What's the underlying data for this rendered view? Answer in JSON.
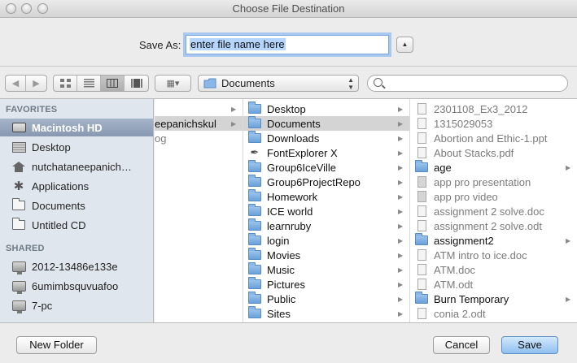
{
  "window": {
    "title": "Choose File Destination"
  },
  "save_as": {
    "label": "Save As:",
    "value": "enter file name here"
  },
  "toolbar": {
    "nav_back": "◀",
    "nav_forward": "▶",
    "arrange_icon": "▦▾",
    "path_selection": "Documents",
    "search_placeholder": ""
  },
  "sidebar": {
    "favorites_header": "FAVORITES",
    "favorites": [
      {
        "label": "Macintosh HD",
        "icon": "hard-drive-icon",
        "selected": true
      },
      {
        "label": "Desktop",
        "icon": "desktop-icon"
      },
      {
        "label": "nutchataneepanich…",
        "icon": "home-icon"
      },
      {
        "label": "Applications",
        "icon": "applications-icon"
      },
      {
        "label": "Documents",
        "icon": "documents-icon"
      },
      {
        "label": "Untitled CD",
        "icon": "cd-icon"
      }
    ],
    "shared_header": "SHARED",
    "shared": [
      {
        "label": "2012-13486e133e",
        "icon": "computer-icon"
      },
      {
        "label": "6umimbsquvuafoo",
        "icon": "computer-icon"
      },
      {
        "label": "7-pc",
        "icon": "computer-icon"
      }
    ]
  },
  "columns": {
    "col1": [
      {
        "label": "",
        "arrow": true
      },
      {
        "label": "eepanichskul",
        "arrow": true,
        "selected": true
      },
      {
        "label": "og",
        "arrow": false,
        "dim": true
      }
    ],
    "col2": [
      {
        "label": "Desktop",
        "icon": "folder-icon"
      },
      {
        "label": "Documents",
        "icon": "folder-icon",
        "selected": true
      },
      {
        "label": "Downloads",
        "icon": "folder-icon"
      },
      {
        "label": "FontExplorer X",
        "icon": "fontexplorer-icon"
      },
      {
        "label": "Group6IceVille",
        "icon": "folder-icon"
      },
      {
        "label": "Group6ProjectRepo",
        "icon": "folder-icon"
      },
      {
        "label": "Homework",
        "icon": "folder-icon"
      },
      {
        "label": "ICE world",
        "icon": "folder-icon"
      },
      {
        "label": "learnruby",
        "icon": "folder-icon"
      },
      {
        "label": "login",
        "icon": "folder-icon"
      },
      {
        "label": "Movies",
        "icon": "folder-icon"
      },
      {
        "label": "Music",
        "icon": "folder-icon"
      },
      {
        "label": "Pictures",
        "icon": "folder-icon"
      },
      {
        "label": "Public",
        "icon": "folder-icon"
      },
      {
        "label": "Sites",
        "icon": "folder-icon"
      }
    ],
    "col3": [
      {
        "label": "2301108_Ex3_2012",
        "type": "doc",
        "dim": true
      },
      {
        "label": "1315029053",
        "type": "doc",
        "dim": true
      },
      {
        "label": "Abortion and Ethic-1.ppt",
        "type": "doc",
        "dim": true
      },
      {
        "label": "About Stacks.pdf",
        "type": "doc",
        "dim": true
      },
      {
        "label": "age",
        "type": "folder",
        "arrow": true
      },
      {
        "label": "app pro presentation",
        "type": "doc-dark",
        "dim": true
      },
      {
        "label": "app pro video",
        "type": "doc-dark",
        "dim": true
      },
      {
        "label": "assignment 2 solve.doc",
        "type": "doc",
        "dim": true
      },
      {
        "label": "assignment 2 solve.odt",
        "type": "doc",
        "dim": true
      },
      {
        "label": "assignment2",
        "type": "folder",
        "arrow": true
      },
      {
        "label": "ATM intro to ice.doc",
        "type": "doc",
        "dim": true
      },
      {
        "label": "ATM.doc",
        "type": "doc",
        "dim": true
      },
      {
        "label": "ATM.odt",
        "type": "doc",
        "dim": true
      },
      {
        "label": "Burn Temporary",
        "type": "folder",
        "arrow": true
      },
      {
        "label": "conia 2.odt",
        "type": "doc",
        "dim": true
      }
    ]
  },
  "buttons": {
    "new_folder": "New Folder",
    "cancel": "Cancel",
    "save": "Save"
  }
}
